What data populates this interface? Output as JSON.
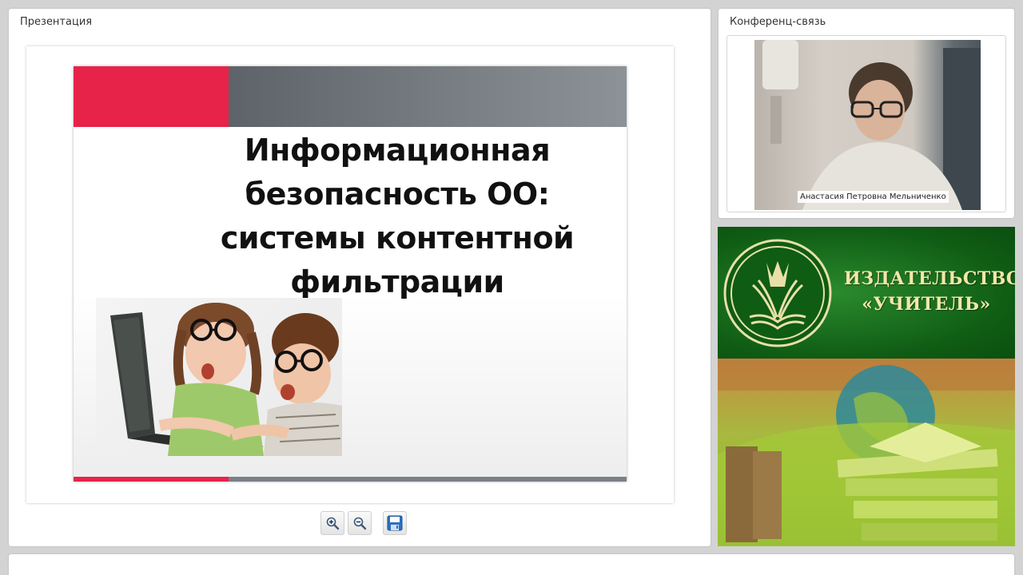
{
  "presentation": {
    "title": "Презентация",
    "slide": {
      "title": "Информационная безопасность ОО: системы контентной фильтрации"
    },
    "toolbar": {
      "zoom_in_icon": "zoom-in-icon",
      "zoom_out_icon": "zoom-out-icon",
      "save_icon": "save-icon"
    }
  },
  "conference": {
    "title": "Конференц-связь",
    "participant_name": "Анастасия Петровна Мельниченко"
  },
  "banner": {
    "line1": "ИЗДАТЕЛЬСТВО",
    "line2": "«УЧИТЕЛЬ»"
  },
  "colors": {
    "accent_red": "#e8234a",
    "banner_green": "#0f5c14",
    "banner_text": "#f3e7a8"
  }
}
